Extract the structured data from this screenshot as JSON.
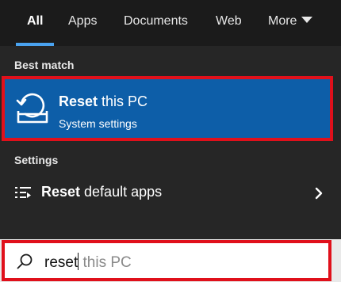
{
  "tabs": [
    {
      "label": "All",
      "active": true
    },
    {
      "label": "Apps",
      "active": false
    },
    {
      "label": "Documents",
      "active": false
    },
    {
      "label": "Web",
      "active": false
    },
    {
      "label": "More",
      "active": false
    }
  ],
  "sections": {
    "best_match_label": "Best match",
    "settings_label": "Settings"
  },
  "best_match": {
    "title_bold": "Reset",
    "title_rest": " this PC",
    "subtitle": "System settings",
    "icon": "reset-pc-icon"
  },
  "settings_results": [
    {
      "label_bold": "Reset",
      "label_rest": " default apps",
      "icon": "app-list-icon"
    }
  ],
  "search": {
    "typed": "reset",
    "suggestion": " this PC",
    "icon": "search-icon"
  },
  "colors": {
    "accent": "#4aa3f0",
    "selection": "#0d5ea8",
    "highlight_border": "#e0101b"
  }
}
